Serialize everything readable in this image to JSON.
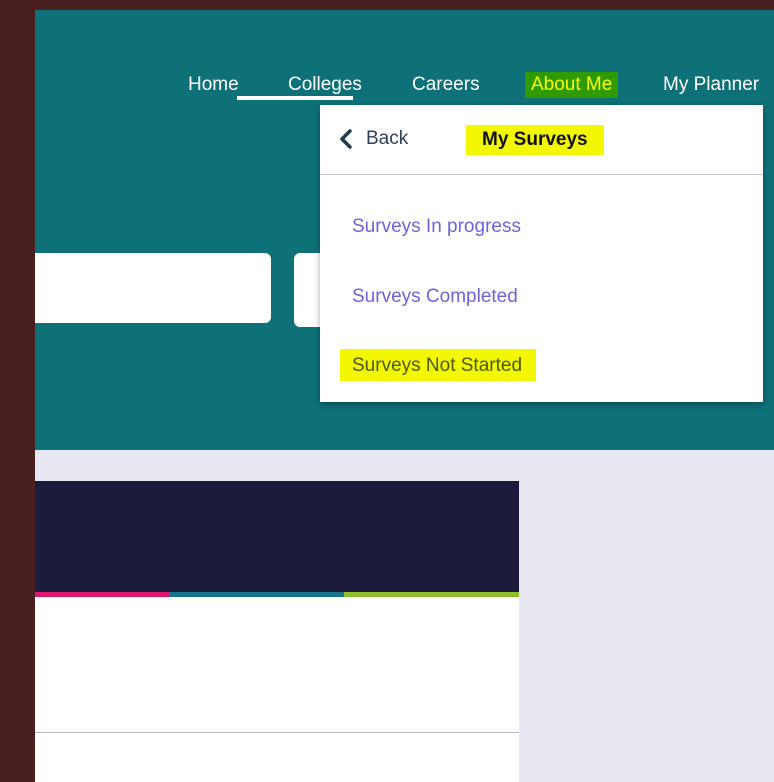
{
  "nav": {
    "items": [
      {
        "label": "Home"
      },
      {
        "label": "Colleges"
      },
      {
        "label": "Careers"
      },
      {
        "label": "About Me"
      },
      {
        "label": "My Planner"
      }
    ]
  },
  "dropdown": {
    "back_label": "Back",
    "title": "My Surveys",
    "items": [
      {
        "label": "Surveys In progress"
      },
      {
        "label": "Surveys Completed"
      },
      {
        "label": "Surveys Not Started"
      }
    ]
  },
  "colors": {
    "header_bg": "#0e7178",
    "link": "#6d63e0",
    "highlight": "#f3f700",
    "card_header": "#1c1b3b"
  },
  "icons": {
    "back": "chevron-left-icon"
  }
}
